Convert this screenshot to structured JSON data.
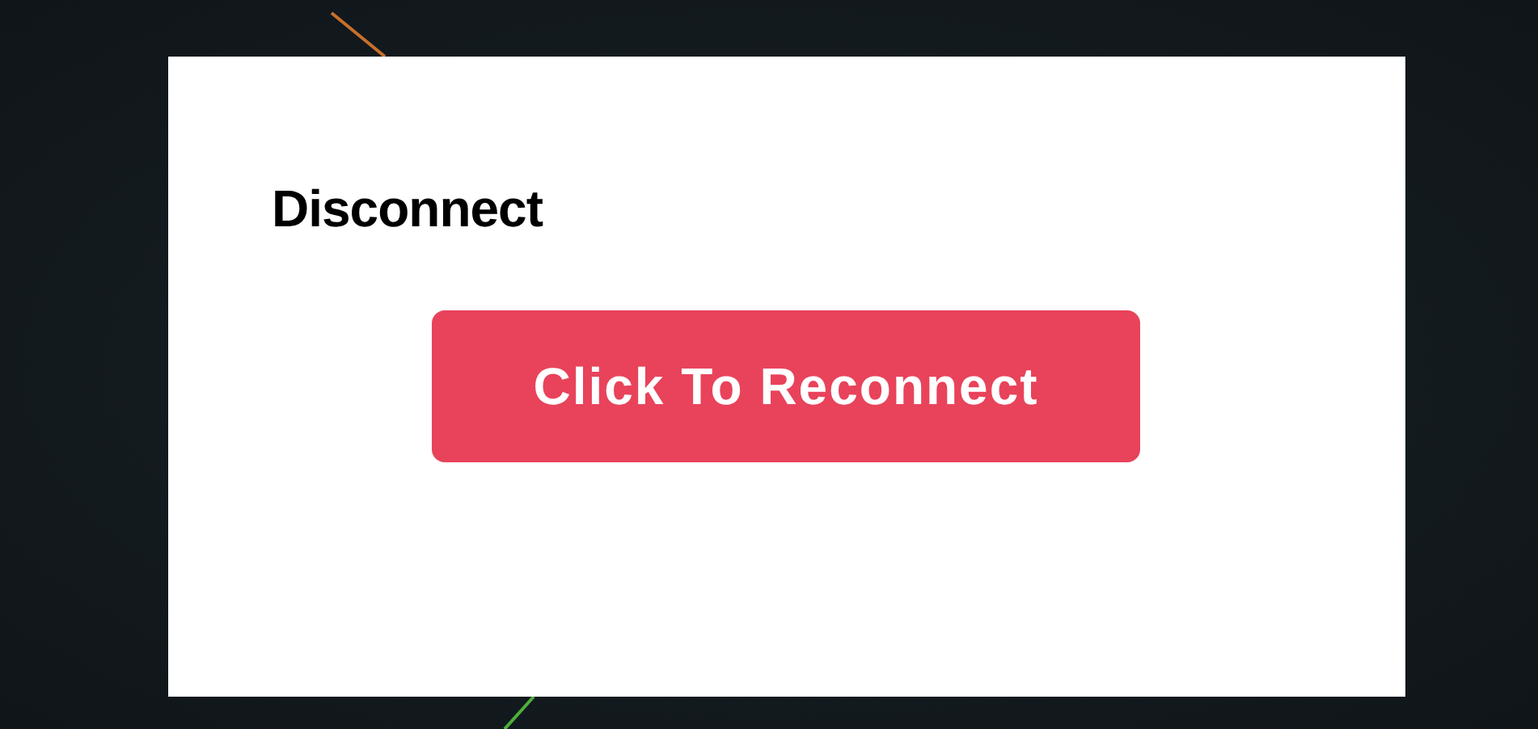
{
  "dialog": {
    "title": "Disconnect",
    "button": "Click To Reconnect"
  }
}
